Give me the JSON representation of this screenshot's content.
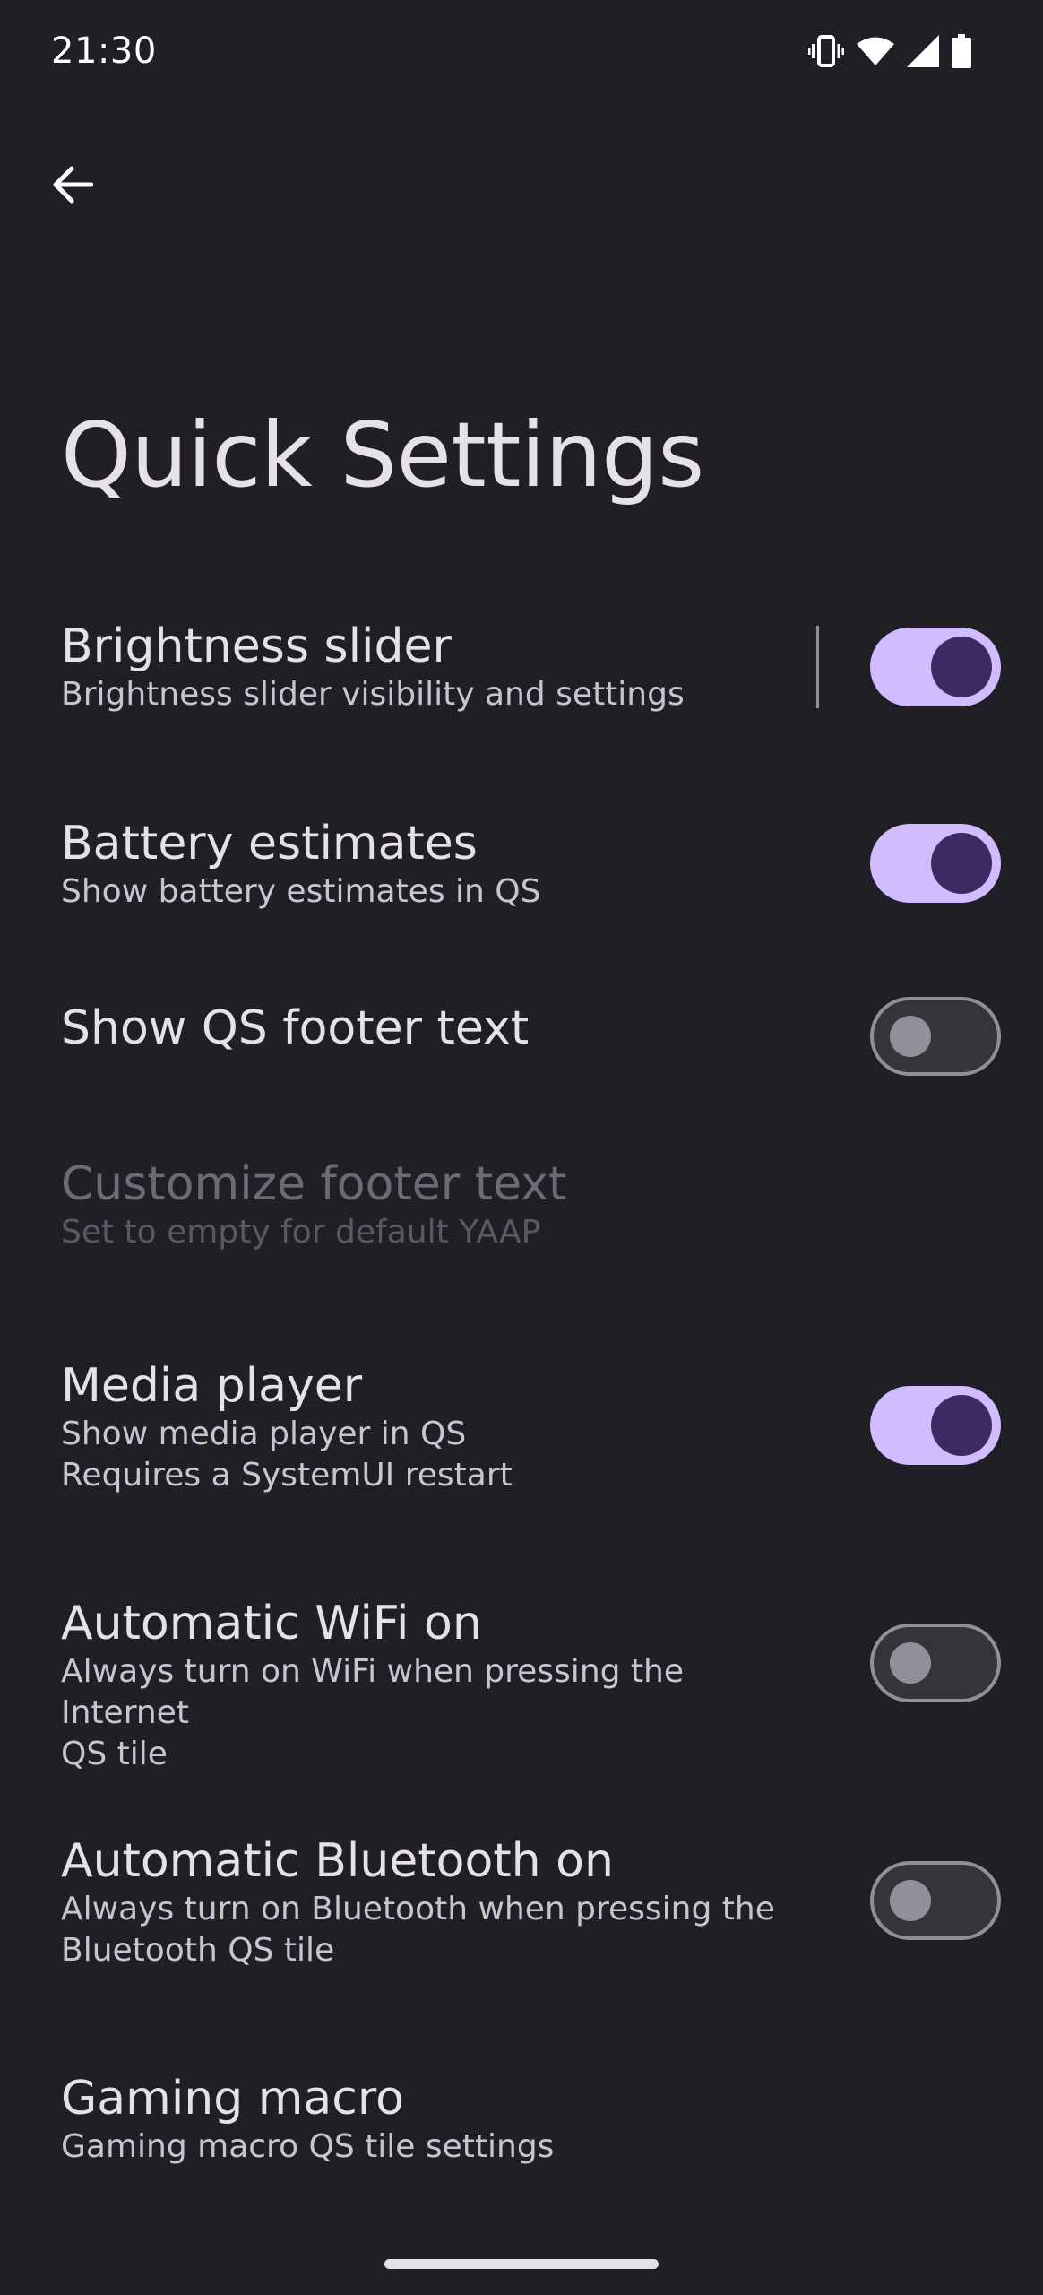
{
  "status_bar": {
    "time": "21:30",
    "icons": [
      "vibrate-icon",
      "wifi-icon",
      "signal-icon",
      "battery-icon"
    ]
  },
  "header": {
    "back_icon": "arrow-left-icon",
    "title": "Quick Settings"
  },
  "settings": [
    {
      "title": "Brightness slider",
      "summary": "Brightness slider visibility and settings",
      "toggle": "on",
      "has_divider": true,
      "enabled": true
    },
    {
      "title": "Battery estimates",
      "summary": "Show battery estimates in QS",
      "toggle": "on",
      "enabled": true
    },
    {
      "title": "Show QS footer text",
      "summary": "",
      "toggle": "off",
      "enabled": true
    },
    {
      "title": "Customize footer text",
      "summary": "Set to empty for default YAAP",
      "toggle": null,
      "enabled": false
    },
    {
      "title": "Media player",
      "summary": "Show media player in QS",
      "summary2": "Requires a SystemUI restart",
      "toggle": "on",
      "enabled": true
    },
    {
      "title": "Automatic WiFi on",
      "summary": "Always turn on WiFi when pressing the Internet",
      "summary2": "QS tile",
      "toggle": "off",
      "enabled": true
    },
    {
      "title": "Automatic Bluetooth on",
      "summary": "Always turn on Bluetooth when pressing the",
      "summary2": "Bluetooth QS tile",
      "toggle": "off",
      "enabled": true
    },
    {
      "title": "Gaming macro",
      "summary": "Gaming macro QS tile settings",
      "toggle": null,
      "enabled": true
    }
  ],
  "colors": {
    "background": "#211f26",
    "switch_on_track": "#d0bcff",
    "switch_on_thumb": "#3c2a62",
    "switch_off_track": "#36343b",
    "switch_off_outline": "#938f99"
  }
}
